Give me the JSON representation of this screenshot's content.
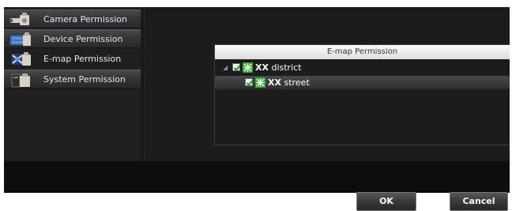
{
  "sidebar": {
    "items": [
      {
        "label": "Camera Permission",
        "icon": "camera-icon"
      },
      {
        "label": "Device Permission",
        "icon": "device-icon"
      },
      {
        "label": "E-map Permission",
        "icon": "emap-icon"
      },
      {
        "label": "System Permission",
        "icon": "system-icon"
      }
    ]
  },
  "panel": {
    "title": "E-map Permission",
    "tree": {
      "expander": "◢",
      "root": {
        "prefix": "XX",
        "suffix": "district",
        "checked": true
      },
      "child": {
        "prefix": "XX",
        "suffix": "street",
        "checked": true
      }
    }
  },
  "buttons": {
    "ok": "OK",
    "cancel": "Cancel"
  },
  "colors": {
    "check": "#1f9a1f",
    "emap_icon": "#2eae2e",
    "background": "#1b1b1c"
  }
}
